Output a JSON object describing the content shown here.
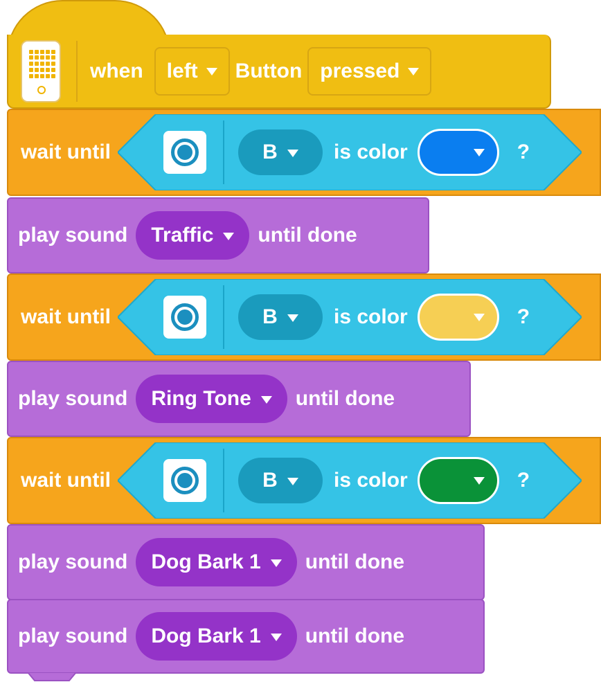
{
  "hat": {
    "when": "when",
    "button_value": "left",
    "button_label": "Button",
    "action_value": "pressed"
  },
  "program": [
    {
      "type": "wait",
      "label": "wait until",
      "port": "B",
      "is_color": "is color",
      "color": "#0a7ef0",
      "question": "?"
    },
    {
      "type": "sound",
      "label": "play sound",
      "sound": "Traffic",
      "suffix": "until done"
    },
    {
      "type": "wait",
      "label": "wait until",
      "port": "B",
      "is_color": "is color",
      "color": "#f6cf54",
      "question": "?"
    },
    {
      "type": "sound",
      "label": "play sound",
      "sound": "Ring Tone",
      "suffix": "until done"
    },
    {
      "type": "wait",
      "label": "wait until",
      "port": "B",
      "is_color": "is color",
      "color": "#0a9238",
      "question": "?"
    },
    {
      "type": "sound",
      "label": "play sound",
      "sound": "Dog Bark 1",
      "suffix": "until done"
    },
    {
      "type": "sound",
      "label": "play sound",
      "sound": "Dog Bark 1",
      "suffix": "until done"
    }
  ],
  "colors": {
    "event_yellow": "#f0be12",
    "control_orange": "#f6a51c",
    "sensor_cyan": "#35c3e6",
    "sound_purple": "#b66cd8"
  }
}
